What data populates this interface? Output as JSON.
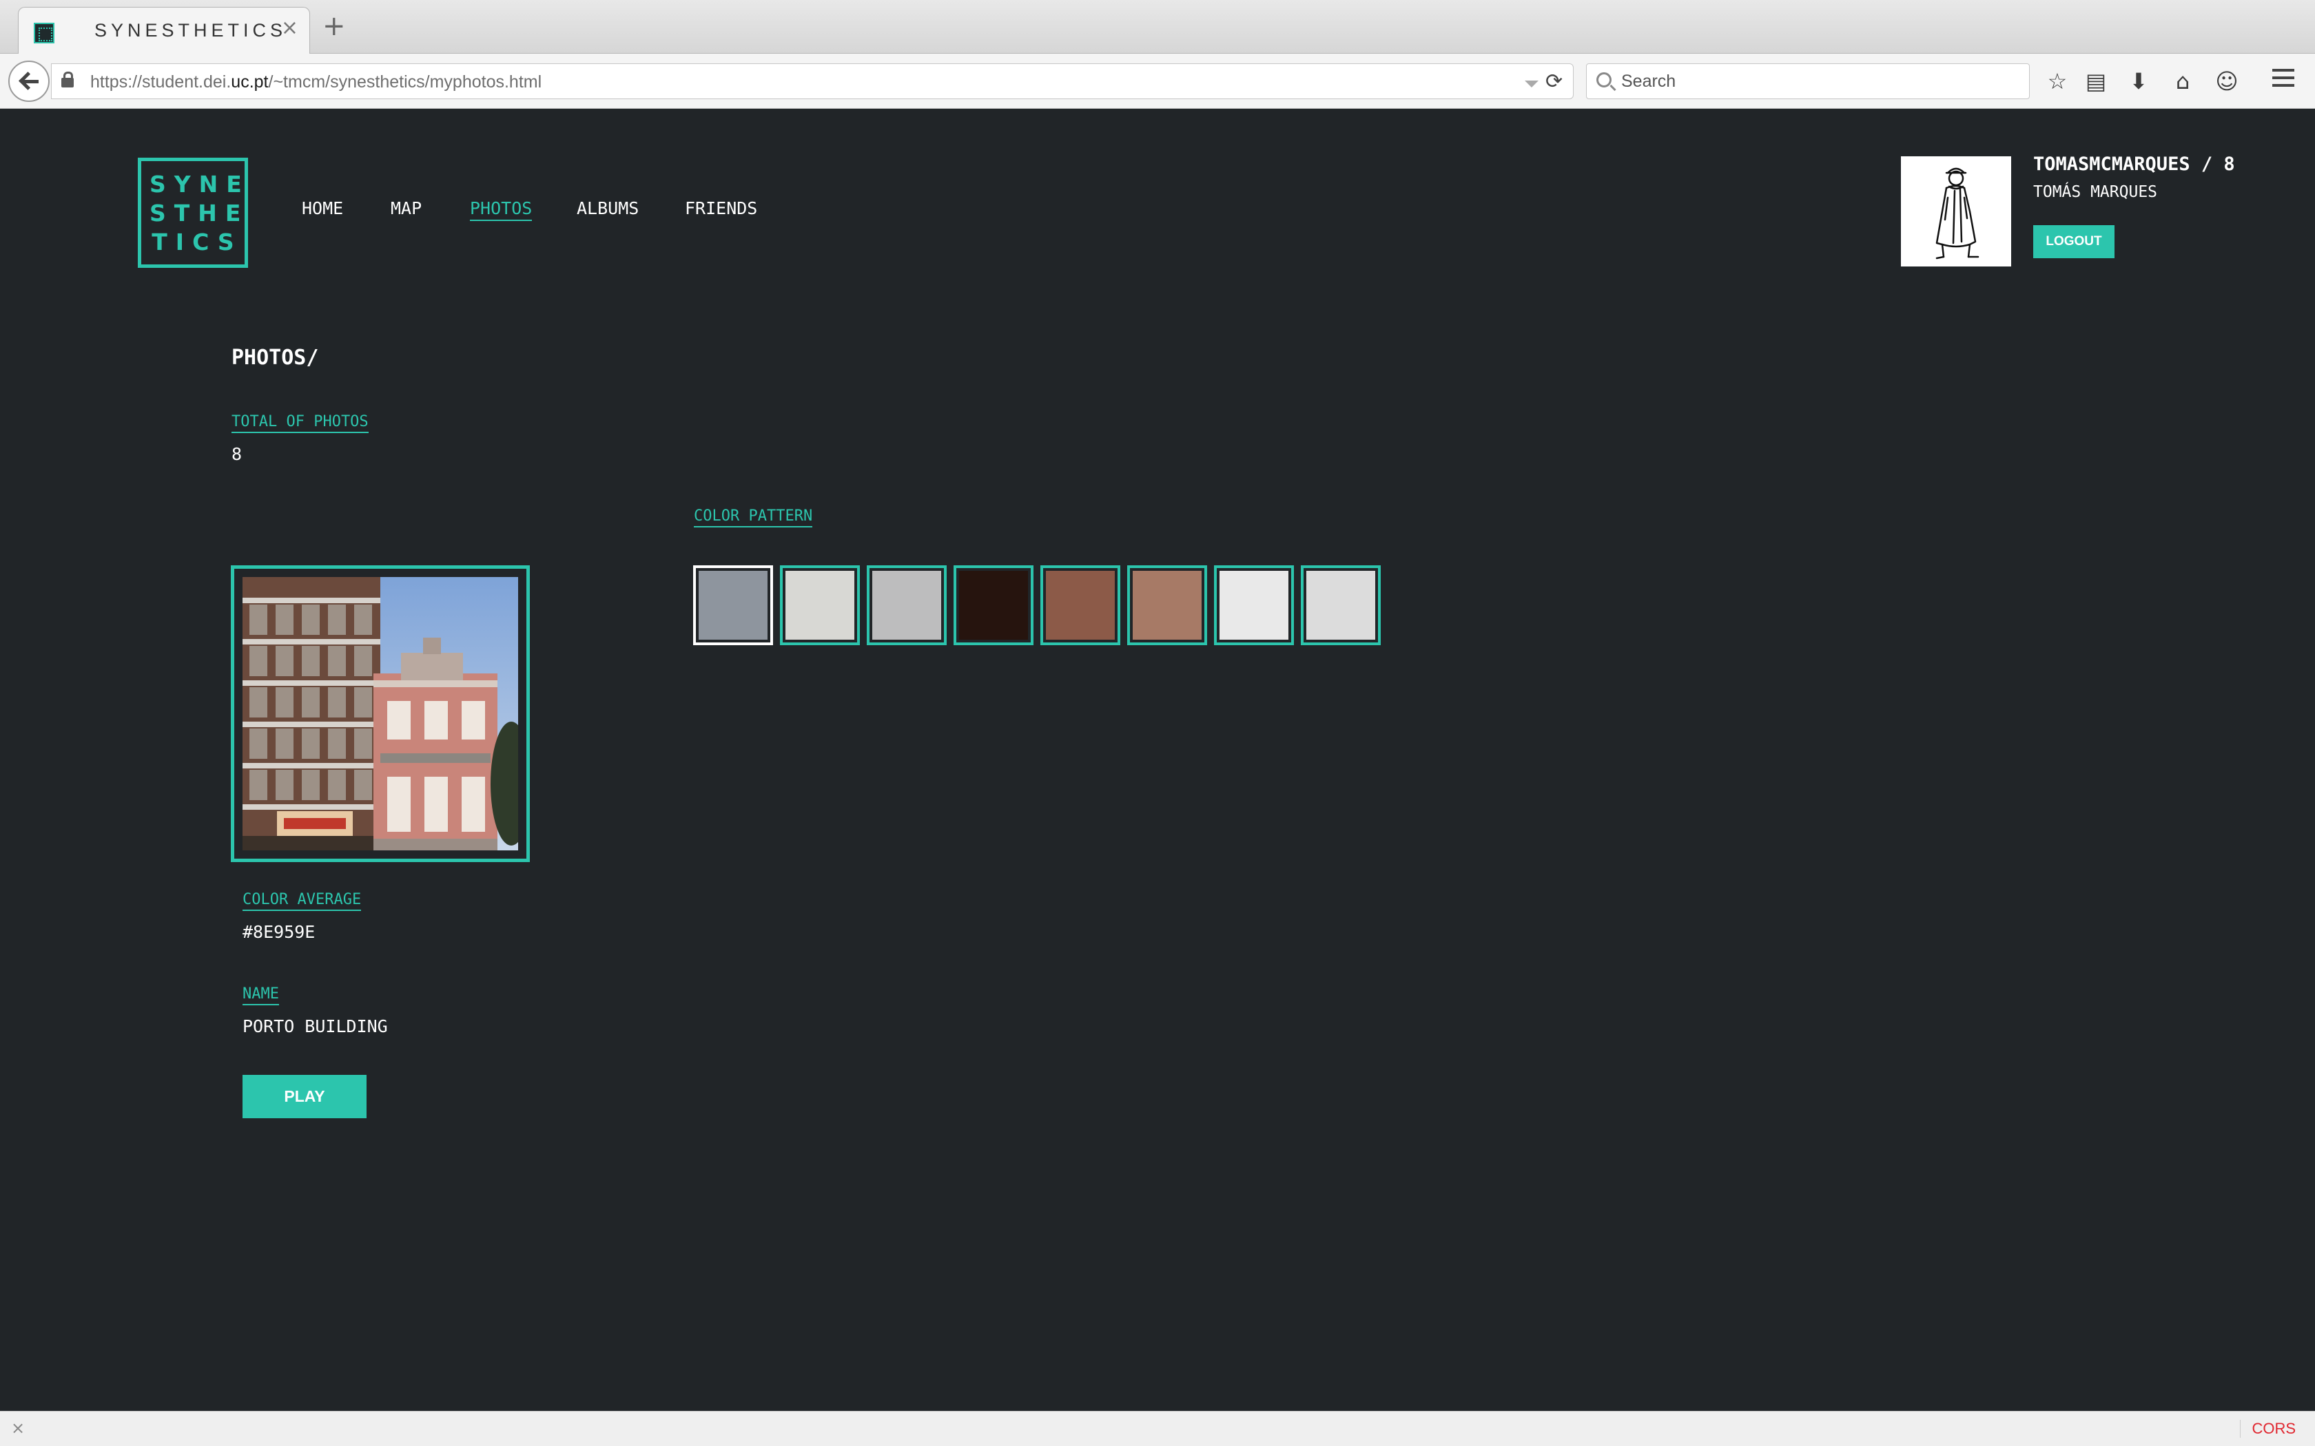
{
  "browser": {
    "tab_title": "SYNESTHETICS",
    "url": {
      "prefix": "https://student.dei.",
      "domain": "uc.pt",
      "path": "/~tmcm/synesthetics/myphotos.html"
    },
    "search_placeholder": "Search",
    "icons": [
      "back-arrow-icon",
      "lock-icon",
      "reload-icon",
      "search-icon",
      "star-icon",
      "reading-list-icon",
      "download-icon",
      "home-icon",
      "chat-icon",
      "hamburger-menu-icon"
    ]
  },
  "site": {
    "logo_lines": [
      "SYNE",
      "STHE",
      "TICS"
    ],
    "nav": [
      {
        "label": "HOME",
        "active": false
      },
      {
        "label": "MAP",
        "active": false
      },
      {
        "label": "PHOTOS",
        "active": true
      },
      {
        "label": "ALBUMS",
        "active": false
      },
      {
        "label": "FRIENDS",
        "active": false
      }
    ],
    "user": {
      "username_line": "TOMASMCMARQUES / 8",
      "full_name": "TOMÁS MARQUES",
      "logout_label": "LOGOUT"
    }
  },
  "main": {
    "title": "PHOTOS/",
    "total_label": "TOTAL OF PHOTOS",
    "total_value": "8",
    "color_pattern_label": "COLOR PATTERN",
    "color_pattern": [
      "#8E959E",
      "#D8D8D4",
      "#BDBDBE",
      "#26140E",
      "#8C5A48",
      "#A77A66",
      "#E9E9E9",
      "#DCDCDC"
    ],
    "selected_swatch": 0,
    "color_average_label": "COLOR AVERAGE",
    "color_average_value": "#8E959E",
    "name_label": "NAME",
    "name_value": "PORTO BUILDING",
    "play_label": "PLAY"
  },
  "statusbar": {
    "close": "×",
    "cors": "CORS"
  },
  "colors": {
    "accent": "#2cc5ad",
    "background": "#212528"
  }
}
